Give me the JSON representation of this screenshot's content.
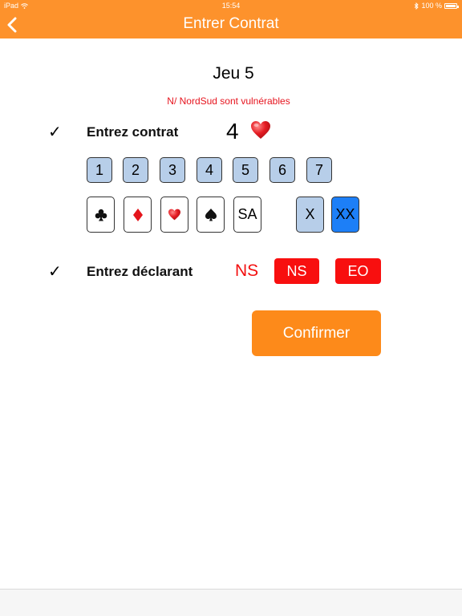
{
  "status_bar": {
    "device": "iPad",
    "time": "15:54",
    "battery": "100 %"
  },
  "header": {
    "title": "Entrer Contrat"
  },
  "game": {
    "title": "Jeu 5",
    "vulnerability": "N/ NordSud sont vulnérables"
  },
  "contract": {
    "label": "Entrez contrat",
    "check": "✓",
    "level_value": "4",
    "suit_value_icon": "heart-icon",
    "levels": [
      "1",
      "2",
      "3",
      "4",
      "5",
      "6",
      "7"
    ],
    "sa_label": "SA",
    "double_label": "X",
    "redouble_label": "XX"
  },
  "declarer": {
    "label": "Entrez déclarant",
    "check": "✓",
    "value": "NS",
    "ns_label": "NS",
    "eo_label": "EO"
  },
  "confirm_label": "Confirmer",
  "colors": {
    "header": "#fd922c",
    "confirm": "#fd8a1a",
    "level_button": "#b7cee9",
    "selected_button": "#1d7ff7",
    "red": "#f80f0f"
  }
}
